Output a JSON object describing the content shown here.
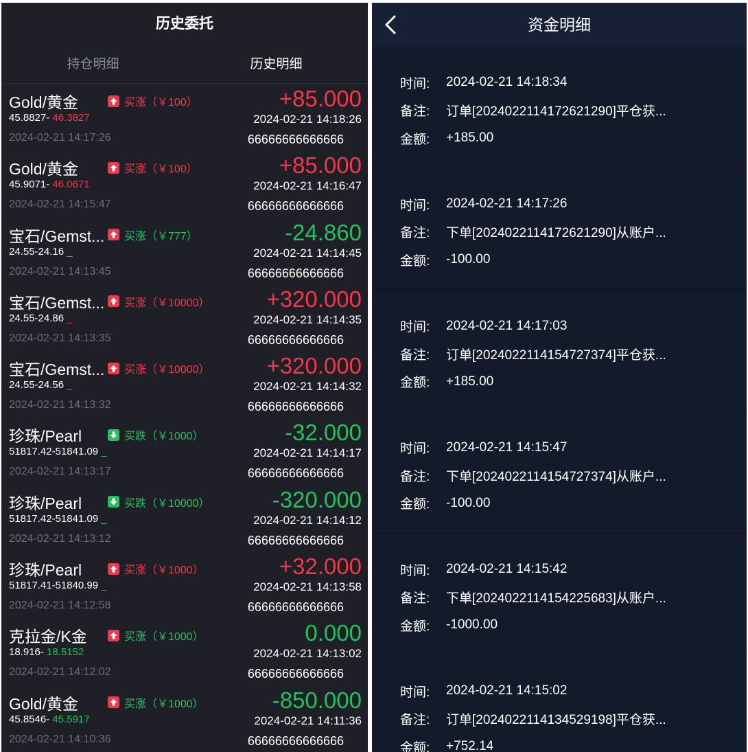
{
  "left": {
    "title": "历史委托",
    "tabs": [
      {
        "label": "持仓明细",
        "active": false
      },
      {
        "label": "历史明细",
        "active": true
      }
    ],
    "rows": [
      {
        "name": "Gold/黄金",
        "dir_icon": "up-arrow-icon",
        "dir_icon_color": "red",
        "dir_label": "买涨",
        "amount": "（￥100）",
        "dir_color": "red",
        "price_a": "45.8827-",
        "price_b": " 46.3827",
        "price_b_color": "red",
        "open_time": "2024-02-21 14:17:26",
        "pnl": "+85.000",
        "pnl_color": "red",
        "close_time": "2024-02-21 14:18:26",
        "code": "66666666666666"
      },
      {
        "name": "Gold/黄金",
        "dir_icon": "up-arrow-icon",
        "dir_icon_color": "red",
        "dir_label": "买涨",
        "amount": "（￥100）",
        "dir_color": "red",
        "price_a": "45.9071-",
        "price_b": " 46.0671",
        "price_b_color": "red",
        "open_time": "2024-02-21 14:15:47",
        "pnl": "+85.000",
        "pnl_color": "red",
        "close_time": "2024-02-21 14:16:47",
        "code": "66666666666666"
      },
      {
        "name": "宝石/Gemst...",
        "dir_icon": "up-arrow-icon",
        "dir_icon_color": "red",
        "dir_label": "买涨",
        "amount": "（￥777）",
        "dir_color": "green",
        "price_a": "24.55-24.16",
        "price_b": " _",
        "price_b_color": "green",
        "open_time": "2024-02-21 14:13:45",
        "pnl": "-24.860",
        "pnl_color": "green",
        "close_time": "2024-02-21 14:14:45",
        "code": "66666666666666"
      },
      {
        "name": "宝石/Gemst...",
        "dir_icon": "up-arrow-icon",
        "dir_icon_color": "red",
        "dir_label": "买涨",
        "amount": "（￥10000）",
        "dir_color": "red",
        "price_a": "24.55-24.86",
        "price_b": " _",
        "price_b_color": "red",
        "open_time": "2024-02-21 14:13:35",
        "pnl": "+320.000",
        "pnl_color": "red",
        "close_time": "2024-02-21 14:14:35",
        "code": "66666666666666"
      },
      {
        "name": "宝石/Gemst...",
        "dir_icon": "up-arrow-icon",
        "dir_icon_color": "red",
        "dir_label": "买涨",
        "amount": "（￥10000）",
        "dir_color": "red",
        "price_a": "24.55-24.56",
        "price_b": " _",
        "price_b_color": "red",
        "open_time": "2024-02-21 14:13:32",
        "pnl": "+320.000",
        "pnl_color": "red",
        "close_time": "2024-02-21 14:14:32",
        "code": "66666666666666"
      },
      {
        "name": "珍珠/Pearl",
        "dir_icon": "down-arrow-icon",
        "dir_icon_color": "green",
        "dir_label": "买跌",
        "amount": "（￥1000）",
        "dir_color": "green",
        "price_a": "51817.42-51841.09",
        "price_b": " _",
        "price_b_color": "green",
        "open_time": "2024-02-21 14:13:17",
        "pnl": "-32.000",
        "pnl_color": "green",
        "close_time": "2024-02-21 14:14:17",
        "code": "66666666666666"
      },
      {
        "name": "珍珠/Pearl",
        "dir_icon": "down-arrow-icon",
        "dir_icon_color": "green",
        "dir_label": "买跌",
        "amount": "（￥10000）",
        "dir_color": "green",
        "price_a": "51817.42-51841.09",
        "price_b": " _",
        "price_b_color": "green",
        "open_time": "2024-02-21 14:13:12",
        "pnl": "-320.000",
        "pnl_color": "green",
        "close_time": "2024-02-21 14:14:12",
        "code": "66666666666666"
      },
      {
        "name": "珍珠/Pearl",
        "dir_icon": "up-arrow-icon",
        "dir_icon_color": "red",
        "dir_label": "买涨",
        "amount": "（￥1000）",
        "dir_color": "red",
        "price_a": "51817.41-51840.99",
        "price_b": " _",
        "price_b_color": "red",
        "open_time": "2024-02-21 14:12:58",
        "pnl": "+32.000",
        "pnl_color": "red",
        "close_time": "2024-02-21 14:13:58",
        "code": "66666666666666"
      },
      {
        "name": "克拉金/K金",
        "dir_icon": "up-arrow-icon",
        "dir_icon_color": "red",
        "dir_label": "买涨",
        "amount": "（￥1000）",
        "dir_color": "green",
        "price_a": "18.916-",
        "price_b": " 18.5152",
        "price_b_color": "green",
        "open_time": "2024-02-21 14:12:02",
        "pnl": "0.000",
        "pnl_color": "green",
        "close_time": "2024-02-21 14:13:02",
        "code": "66666666666666"
      },
      {
        "name": "Gold/黄金",
        "dir_icon": "up-arrow-icon",
        "dir_icon_color": "red",
        "dir_label": "买涨",
        "amount": "（￥1000）",
        "dir_color": "green",
        "price_a": "45.8546-",
        "price_b": " 45.5917",
        "price_b_color": "green",
        "open_time": "2024-02-21 14:10:36",
        "pnl": "-850.000",
        "pnl_color": "green",
        "close_time": "2024-02-21 14:11:36",
        "code": "66666666666666"
      }
    ]
  },
  "right": {
    "title": "资金明细",
    "back_icon": "chevron-left-icon",
    "labels": {
      "time": "时间:",
      "note": "备注:",
      "amount": "金额:"
    },
    "records": [
      {
        "time": "2024-02-21 14:18:34",
        "note": "订单[2024022114172621290]平仓获...",
        "amount": "+185.00"
      },
      {
        "time": "2024-02-21 14:17:26",
        "note": "下单[2024022114172621290]从账户...",
        "amount": "-100.00"
      },
      {
        "time": "2024-02-21 14:17:03",
        "note": "订单[2024022114154727374]平仓获...",
        "amount": "+185.00"
      },
      {
        "time": "2024-02-21 14:15:47",
        "note": "下单[2024022114154727374]从账户...",
        "amount": "-100.00"
      },
      {
        "time": "2024-02-21 14:15:42",
        "note": "下单[2024022114154225683]从账户...",
        "amount": "-1000.00"
      },
      {
        "time": "2024-02-21 14:15:02",
        "note": "订单[2024022114134529198]平仓获...",
        "amount": "+752.14"
      }
    ]
  },
  "colors": {
    "up": "#f0394b",
    "down": "#23c160",
    "left_bg": "#1f1f27",
    "right_bg": "#131a29"
  }
}
